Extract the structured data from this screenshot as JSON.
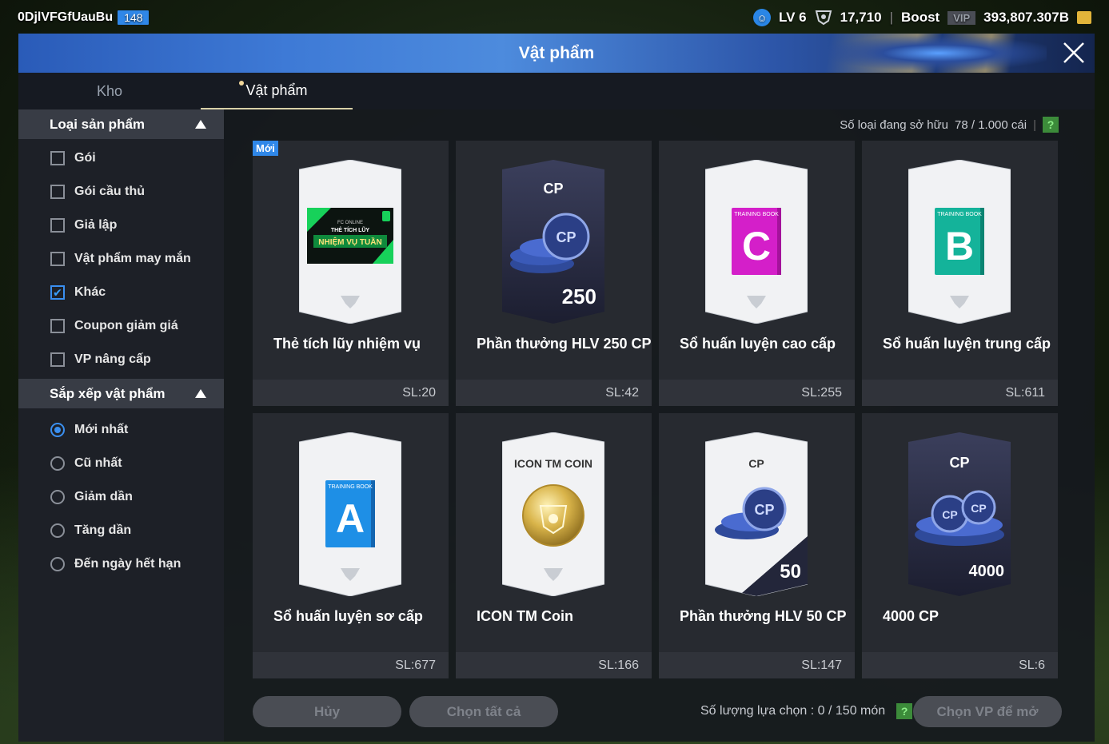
{
  "topbar": {
    "username": "0DjlVFGfUauBu",
    "user_level": "148",
    "lv": "LV 6",
    "trophies": "17,710",
    "boost_label": "Boost",
    "vip_label": "VIP",
    "bp": "393,807.307B"
  },
  "dialog": {
    "title": "Vật phẩm",
    "tabs": [
      {
        "label": "Kho"
      },
      {
        "label": "Vật phẩm"
      }
    ]
  },
  "sidebar": {
    "category_title": "Loại sản phẩm",
    "categories": [
      {
        "label": "Gói",
        "checked": false
      },
      {
        "label": "Gói cầu thủ",
        "checked": false
      },
      {
        "label": "Giả lập",
        "checked": false
      },
      {
        "label": "Vật phẩm may mắn",
        "checked": false
      },
      {
        "label": "Khác",
        "checked": true
      },
      {
        "label": "Coupon giảm giá",
        "checked": false
      },
      {
        "label": "VP nâng cấp",
        "checked": false
      }
    ],
    "sort_title": "Sắp xếp vật phẩm",
    "sorts": [
      {
        "label": "Mới nhất",
        "checked": true
      },
      {
        "label": "Cũ nhất",
        "checked": false
      },
      {
        "label": "Giảm dần",
        "checked": false
      },
      {
        "label": "Tăng dần",
        "checked": false
      },
      {
        "label": "Đến ngày hết hạn",
        "checked": false
      }
    ]
  },
  "owned": {
    "label": "Số loại đang sở hữu",
    "value": "78 / 1.000 cái",
    "help": "?"
  },
  "items": [
    {
      "name": "Thẻ tích lũy nhiệm vụ",
      "qty": "SL:20",
      "badge": "Mới",
      "art": "mission",
      "card_line1": "THẺ TÍCH LŨY",
      "card_line2": "NHIỆM VỤ TUẦN",
      "card_brand": "FC ONLINE"
    },
    {
      "name": "Phần thưởng HLV 250 CP",
      "qty": "SL:42",
      "art": "cp_dark",
      "card_top": "CP",
      "card_amount": "250",
      "coin_text": "CP"
    },
    {
      "name": "Sổ huấn luyện cao cấp",
      "qty": "SL:255",
      "art": "book",
      "book_letter": "C",
      "book_label": "TRAINING BOOK",
      "book_color": "#d41fc9"
    },
    {
      "name": "Sổ huấn luyện trung cấp",
      "qty": "SL:611",
      "art": "book",
      "book_letter": "B",
      "book_label": "TRAINING BOOK",
      "book_color": "#14b39a"
    },
    {
      "name": "Sổ huấn luyện sơ cấp",
      "qty": "SL:677",
      "art": "book",
      "book_letter": "A",
      "book_label": "TRAINING BOOK",
      "book_color": "#1e8fe6"
    },
    {
      "name": "ICON TM Coin",
      "qty": "SL:166",
      "art": "icon_coin",
      "card_top": "ICON TM COIN"
    },
    {
      "name": "Phần thưởng HLV 50 CP",
      "qty": "SL:147",
      "art": "cp_light",
      "card_top": "CP",
      "card_amount": "50",
      "coin_text": "CP"
    },
    {
      "name": "4000 CP",
      "qty": "SL:6",
      "art": "cp_dark2",
      "card_top": "CP",
      "card_amount": "4000",
      "coin_text": "CP"
    }
  ],
  "bottom": {
    "cancel": "Hủy",
    "select_all": "Chọn tất cả",
    "selection_label": "Số lượng lựa chọn : 0 / 150 món",
    "help": "?",
    "open": "Chọn VP để mở"
  },
  "colors": {
    "accent_blue": "#2f87e8",
    "header_blue": "#3e7ad6",
    "help_green": "#3c8b3a"
  }
}
